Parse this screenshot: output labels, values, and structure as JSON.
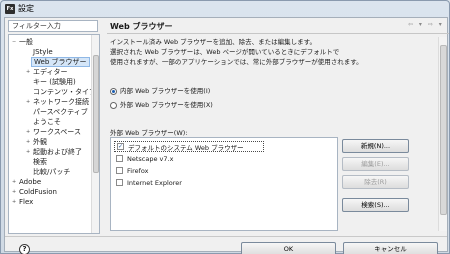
{
  "window": {
    "title": "設定",
    "app_icon": "Fx"
  },
  "sidebar": {
    "filter_placeholder": "フィルター入力",
    "items": [
      {
        "label": "一般",
        "level": 0,
        "expand": "−"
      },
      {
        "label": "JStyle",
        "level": 1
      },
      {
        "label": "Web ブラウザー",
        "level": 1,
        "selected": true
      },
      {
        "label": "エディター",
        "level": 1,
        "expand": "+"
      },
      {
        "label": "キー (試験用)",
        "level": 1
      },
      {
        "label": "コンテンツ・タイプ",
        "level": 1
      },
      {
        "label": "ネットワーク接続",
        "level": 1,
        "expand": "+"
      },
      {
        "label": "パースペクティブ",
        "level": 1
      },
      {
        "label": "ようこそ",
        "level": 1
      },
      {
        "label": "ワークスペース",
        "level": 1,
        "expand": "+"
      },
      {
        "label": "外観",
        "level": 1,
        "expand": "+"
      },
      {
        "label": "起動および終了",
        "level": 1,
        "expand": "+"
      },
      {
        "label": "検索",
        "level": 1
      },
      {
        "label": "比較/パッチ",
        "level": 1
      },
      {
        "label": "Adobe",
        "level": 0,
        "expand": "+"
      },
      {
        "label": "ColdFusion",
        "level": 0,
        "expand": "+"
      },
      {
        "label": "Flex",
        "level": 0,
        "expand": "+"
      }
    ]
  },
  "main": {
    "title": "Web ブラウザー",
    "nav_arrows": "⇦ ▾ ⇨ ▾",
    "description_line1": "インストール済み Web ブラウザーを追加、除去、または編集します。",
    "description_line2": "選択された Web ブラウザーは、Web ページが開いているときにデフォルトで",
    "description_line3": "使用されますが、一部のアプリケーションでは、常に外部ブラウザーが使用されます。",
    "radio_internal": "内部 Web ブラウザーを使用(I)",
    "radio_external": "外部 Web ブラウザーを使用(X)",
    "list_label": "外部 Web ブラウザー(W):",
    "browsers": [
      {
        "label": "デフォルトのシステム Web ブラウザー",
        "checked": true
      },
      {
        "label": "Netscape v7.x",
        "checked": false
      },
      {
        "label": "Firefox",
        "checked": false
      },
      {
        "label": "Internet Explorer",
        "checked": false
      }
    ],
    "buttons": {
      "new": "新規(N)...",
      "edit": "編集(E)...",
      "remove": "除去(R)",
      "search": "検索(S)..."
    }
  },
  "footer": {
    "help": "?",
    "ok": "OK",
    "cancel": "キャンセル"
  }
}
